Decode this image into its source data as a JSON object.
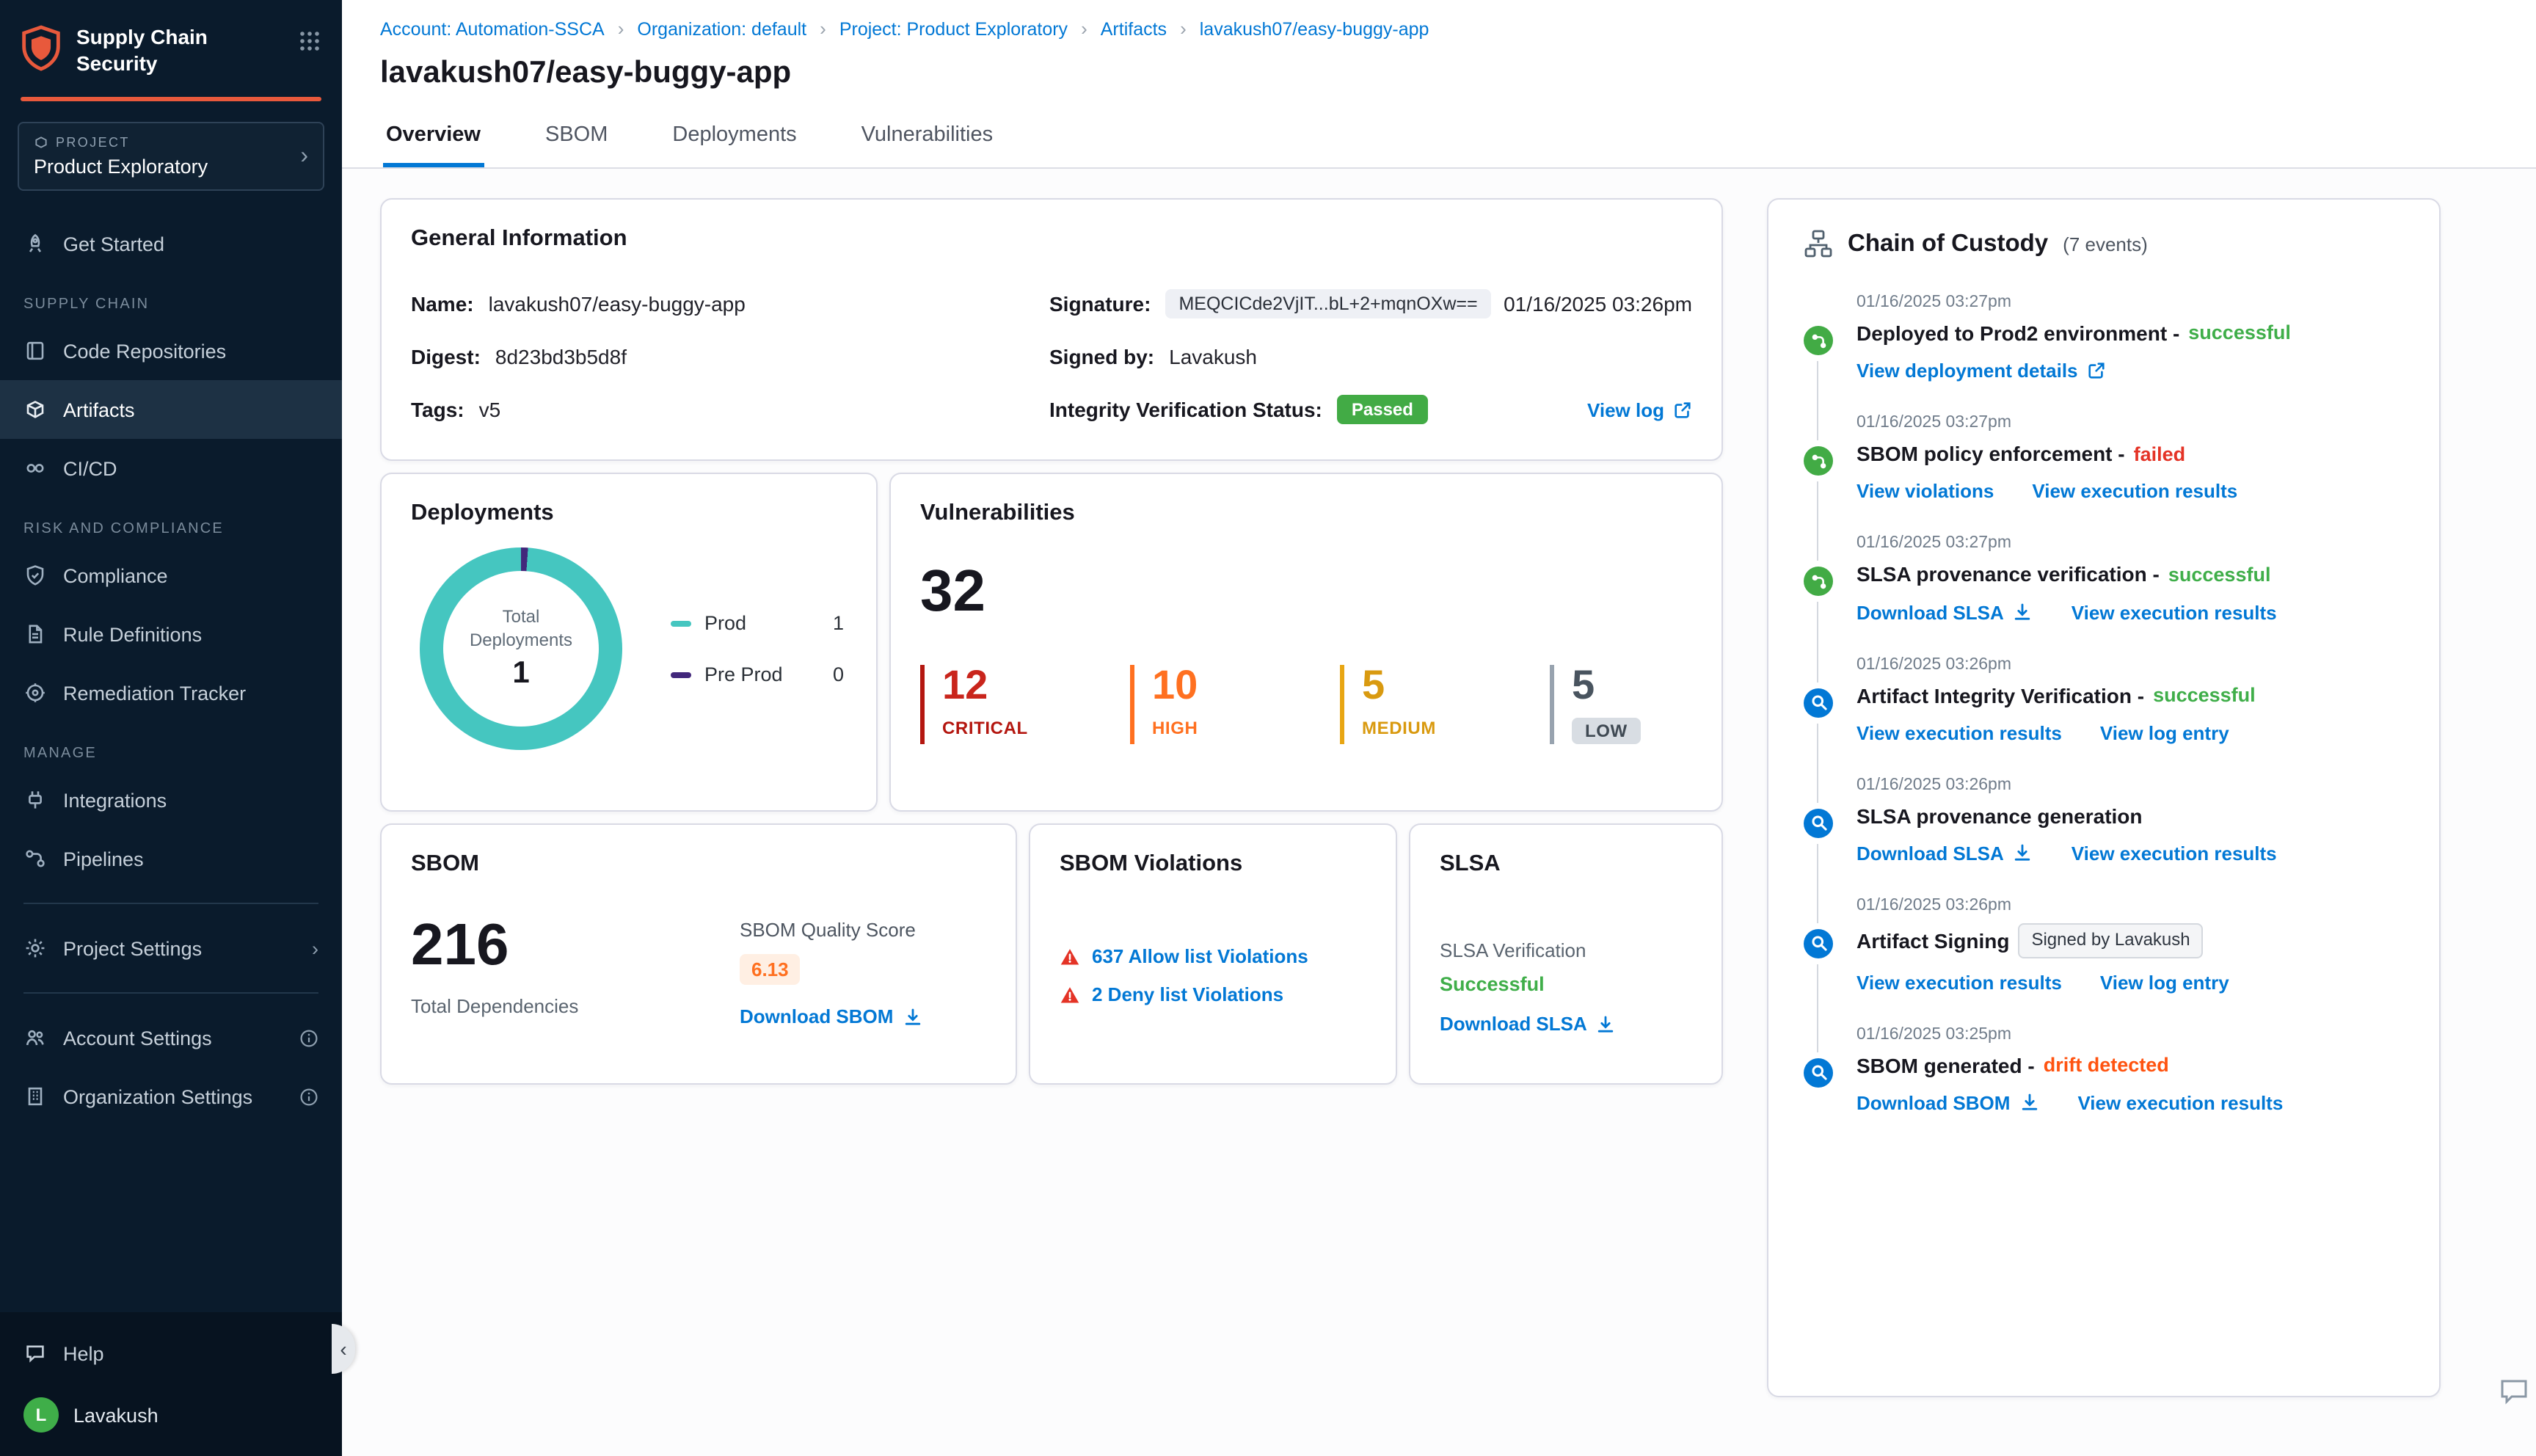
{
  "icons": {
    "chevron_right": "›",
    "chevron_left": "‹",
    "breadcrumb_separator": "›"
  },
  "colors": {
    "accent_blue": "#0278d5",
    "brand_orange": "#e8593c",
    "success_green": "#3fae49",
    "error_red": "#e43326",
    "drift_orange": "#ff5310",
    "donut_teal": "#45c6c0",
    "donut_purple": "#42277b",
    "critical_red": "#b41710",
    "high_orange": "#ff7020",
    "medium_amber": "#e8a613"
  },
  "sidebar": {
    "brand_line1": "Supply Chain",
    "brand_line2": "Security",
    "project_label": "PROJECT",
    "project_name": "Product Exploratory",
    "nav": {
      "get_started": "Get Started",
      "supply_chain_header": "SUPPLY CHAIN",
      "code_repositories": "Code Repositories",
      "artifacts": "Artifacts",
      "cicd": "CI/CD",
      "risk_header": "RISK AND COMPLIANCE",
      "compliance": "Compliance",
      "rule_definitions": "Rule Definitions",
      "remediation_tracker": "Remediation Tracker",
      "manage_header": "MANAGE",
      "integrations": "Integrations",
      "pipelines": "Pipelines",
      "project_settings": "Project Settings",
      "account_settings": "Account Settings",
      "organization_settings": "Organization Settings"
    },
    "help": "Help",
    "user_initial": "L",
    "user_name": "Lavakush"
  },
  "header": {
    "breadcrumb": [
      "Account: Automation-SSCA",
      "Organization: default",
      "Project: Product Exploratory",
      "Artifacts",
      "lavakush07/easy-buggy-app"
    ],
    "title": "lavakush07/easy-buggy-app",
    "tabs": [
      "Overview",
      "SBOM",
      "Deployments",
      "Vulnerabilities"
    ],
    "active_tab": "Overview"
  },
  "general_info": {
    "title": "General Information",
    "name_label": "Name:",
    "name": "lavakush07/easy-buggy-app",
    "digest_label": "Digest:",
    "digest": "8d23bd3b5d8f",
    "tags_label": "Tags:",
    "tags": "v5",
    "signature_label": "Signature:",
    "signature": "MEQCICde2VjIT...bL+2+mqnOXw==",
    "signature_date": "01/16/2025 03:26pm",
    "signed_by_label": "Signed by:",
    "signed_by": "Lavakush",
    "integrity_label": "Integrity Verification Status:",
    "integrity_status": "Passed",
    "view_log": "View log"
  },
  "deployments": {
    "title": "Deployments",
    "center_label": "Total Deployments",
    "total": "1",
    "legend": [
      {
        "label": "Prod",
        "count": "1",
        "color": "#45c6c0"
      },
      {
        "label": "Pre Prod",
        "count": "0",
        "color": "#42277b"
      }
    ]
  },
  "vulnerabilities": {
    "title": "Vulnerabilities",
    "total": "32",
    "severities": [
      {
        "count": "12",
        "label": "CRITICAL",
        "color": "#b41710"
      },
      {
        "count": "10",
        "label": "HIGH",
        "color": "#ff7020"
      },
      {
        "count": "5",
        "label": "MEDIUM",
        "color": "#e8a613"
      },
      {
        "count": "5",
        "label": "LOW",
        "color": "#6b7785"
      }
    ]
  },
  "sbom": {
    "title": "SBOM",
    "total": "216",
    "total_label": "Total Dependencies",
    "quality_label": "SBOM Quality Score",
    "quality_score": "6.13",
    "download": "Download SBOM"
  },
  "sbom_violations": {
    "title": "SBOM Violations",
    "items": [
      {
        "label": "637 Allow list Violations"
      },
      {
        "label": "2 Deny list Violations"
      }
    ]
  },
  "slsa": {
    "title": "SLSA",
    "verification_label": "SLSA Verification",
    "status": "Successful",
    "download": "Download SLSA"
  },
  "chain_of_custody": {
    "title": "Chain of Custody",
    "events_count": "(7 events)",
    "events": [
      {
        "time": "01/16/2025 03:27pm",
        "title": "Deployed to Prod2 environment -",
        "status": "successful",
        "links": [
          {
            "label": "View deployment details",
            "icon": "external"
          }
        ]
      },
      {
        "time": "01/16/2025 03:27pm",
        "title": "SBOM policy enforcement -",
        "status": "failed",
        "links": [
          {
            "label": "View violations"
          },
          {
            "label": "View execution results"
          }
        ]
      },
      {
        "time": "01/16/2025 03:27pm",
        "title": "SLSA provenance verification -",
        "status": "successful",
        "links": [
          {
            "label": "Download SLSA",
            "icon": "download"
          },
          {
            "label": "View execution results"
          }
        ]
      },
      {
        "time": "01/16/2025 03:26pm",
        "title": "Artifact Integrity Verification -",
        "status": "successful",
        "links": [
          {
            "label": "View execution results"
          },
          {
            "label": "View log entry"
          }
        ]
      },
      {
        "time": "01/16/2025 03:26pm",
        "title": "SLSA provenance generation",
        "status": "",
        "links": [
          {
            "label": "Download SLSA",
            "icon": "download"
          },
          {
            "label": "View execution results"
          }
        ]
      },
      {
        "time": "01/16/2025 03:26pm",
        "title": "Artifact Signing",
        "status": "",
        "badge": "Signed by Lavakush",
        "links": [
          {
            "label": "View execution results"
          },
          {
            "label": "View log entry"
          }
        ]
      },
      {
        "time": "01/16/2025 03:25pm",
        "title": "SBOM generated -",
        "status": "drift detected",
        "links": [
          {
            "label": "Download SBOM",
            "icon": "download"
          },
          {
            "label": "View execution results"
          }
        ]
      }
    ]
  }
}
